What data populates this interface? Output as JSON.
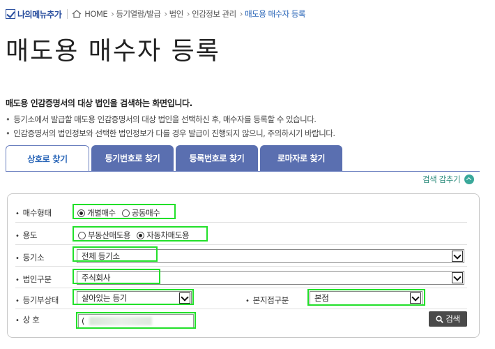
{
  "header": {
    "my_menu_label": "나의메뉴추가",
    "breadcrumb": [
      "HOME",
      "등기열람/발급",
      "법인",
      "인감정보 관리",
      "매도용 매수자 등록"
    ]
  },
  "page": {
    "title": "매도용 매수자 등록"
  },
  "description": {
    "heading": "매도용 인감증명서의 대상 법인을 검색하는 화면입니다.",
    "items": [
      "등기소에서 발급할 매도용 인감증명서의 대상 법인을 선택하신 후, 매수자를 등록할 수 있습니다.",
      "인감증명서의 법인정보와 선택한 법인정보가 다를 경우 발급이 진행되지 않으니, 주의하시기 바랍니다."
    ]
  },
  "tabs": [
    {
      "label": "상호로 찾기",
      "active": true
    },
    {
      "label": "등기번호로 찾기",
      "active": false
    },
    {
      "label": "등록번호로 찾기",
      "active": false
    },
    {
      "label": "로마자로 찾기",
      "active": false
    }
  ],
  "collapse_label": "검색 감추기",
  "form": {
    "purchase_type": {
      "label": "매수형태",
      "options": [
        "개별매수",
        "공동매수"
      ],
      "selected": "개별매수"
    },
    "usage": {
      "label": "용도",
      "options": [
        "부동산매도용",
        "자동차매도용"
      ],
      "selected": "자동차매도용"
    },
    "registry_office": {
      "label": "등기소",
      "value": "전체 등기소"
    },
    "corp_type": {
      "label": "법인구분",
      "value": "주식회사"
    },
    "registry_status": {
      "label": "등기부상태",
      "value": "살아있는 등기"
    },
    "branch_type": {
      "label": "본지점구분",
      "value": "본점"
    },
    "company_name": {
      "label": "상 호",
      "value": "("
    },
    "search_button": "검색"
  },
  "colors": {
    "tab_bg": "#5a6fb0",
    "highlight": "#22e02a",
    "accent": "#2a66b8"
  }
}
